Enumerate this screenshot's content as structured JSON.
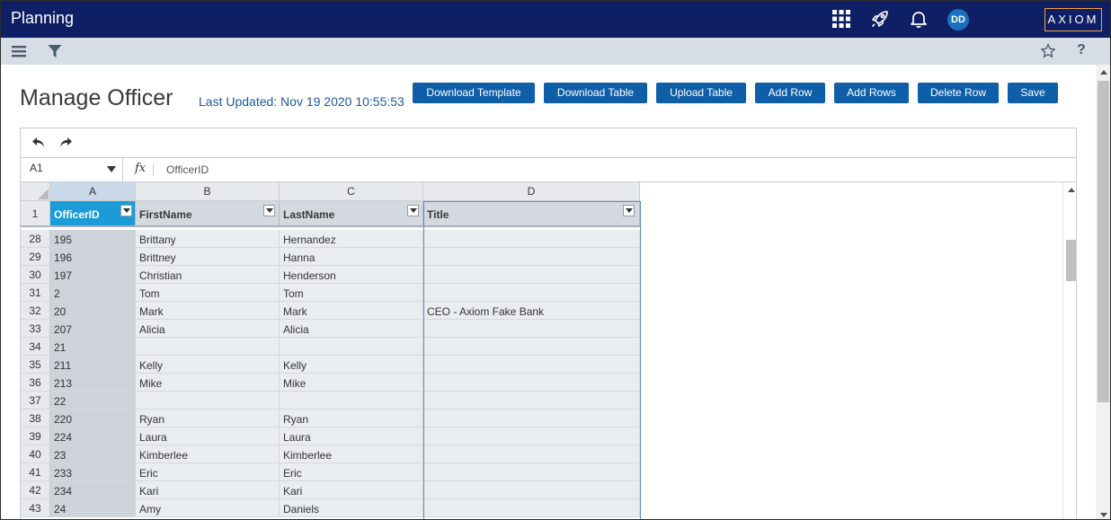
{
  "topbar": {
    "title": "Planning",
    "avatar_initials": "DD",
    "logo_text": "AXIOM",
    "icons": [
      "app-grid-icon",
      "rocket-icon",
      "bell-icon"
    ]
  },
  "subbar": {
    "icons": [
      "menu-icon",
      "filter-icon",
      "star-icon",
      "help-icon"
    ],
    "help_glyph": "?"
  },
  "page": {
    "title": "Manage Officer",
    "last_updated": "Last Updated: Nov 19 2020 10:55:53"
  },
  "buttons": [
    {
      "label": "Download Template"
    },
    {
      "label": "Download Table"
    },
    {
      "label": "Upload Table"
    },
    {
      "label": "Add Row"
    },
    {
      "label": "Add Rows"
    },
    {
      "label": "Delete Row"
    },
    {
      "label": "Save"
    }
  ],
  "formula_bar": {
    "cell_ref": "A1",
    "fx_label": "fx",
    "formula_value": "OfficerID"
  },
  "grid": {
    "column_letters": [
      "A",
      "B",
      "C",
      "D"
    ],
    "header_row_number": "1",
    "headers": [
      "OfficerID",
      "FirstName",
      "LastName",
      "Title"
    ],
    "rows": [
      {
        "num": "28",
        "cells": [
          "195",
          "Brittany",
          "Hernandez",
          ""
        ]
      },
      {
        "num": "29",
        "cells": [
          "196",
          "Brittney",
          "Hanna",
          ""
        ]
      },
      {
        "num": "30",
        "cells": [
          "197",
          "Christian",
          "Henderson",
          ""
        ]
      },
      {
        "num": "31",
        "cells": [
          "2",
          "Tom",
          "Tom",
          ""
        ]
      },
      {
        "num": "32",
        "cells": [
          "20",
          "Mark",
          "Mark",
          "CEO - Axiom Fake Bank"
        ]
      },
      {
        "num": "33",
        "cells": [
          "207",
          "Alicia",
          "Alicia",
          ""
        ]
      },
      {
        "num": "34",
        "cells": [
          "21",
          "",
          "",
          ""
        ]
      },
      {
        "num": "35",
        "cells": [
          "211",
          "Kelly",
          "Kelly",
          ""
        ]
      },
      {
        "num": "36",
        "cells": [
          "213",
          "Mike",
          "Mike",
          ""
        ]
      },
      {
        "num": "37",
        "cells": [
          "22",
          "",
          "",
          ""
        ]
      },
      {
        "num": "38",
        "cells": [
          "220",
          "Ryan",
          "Ryan",
          ""
        ]
      },
      {
        "num": "39",
        "cells": [
          "224",
          "Laura",
          "Laura",
          ""
        ]
      },
      {
        "num": "40",
        "cells": [
          "23",
          "Kimberlee",
          "Kimberlee",
          ""
        ]
      },
      {
        "num": "41",
        "cells": [
          "233",
          "Eric",
          "Eric",
          ""
        ]
      },
      {
        "num": "42",
        "cells": [
          "234",
          "Kari",
          "Kari",
          ""
        ]
      },
      {
        "num": "43",
        "cells": [
          "24",
          "Amy",
          "Daniels",
          ""
        ]
      }
    ]
  },
  "colors": {
    "navbar": "#0f1f66",
    "button": "#0f5ea8",
    "active_header": "#1b9bd8",
    "logo_border": "#f4a43b"
  }
}
